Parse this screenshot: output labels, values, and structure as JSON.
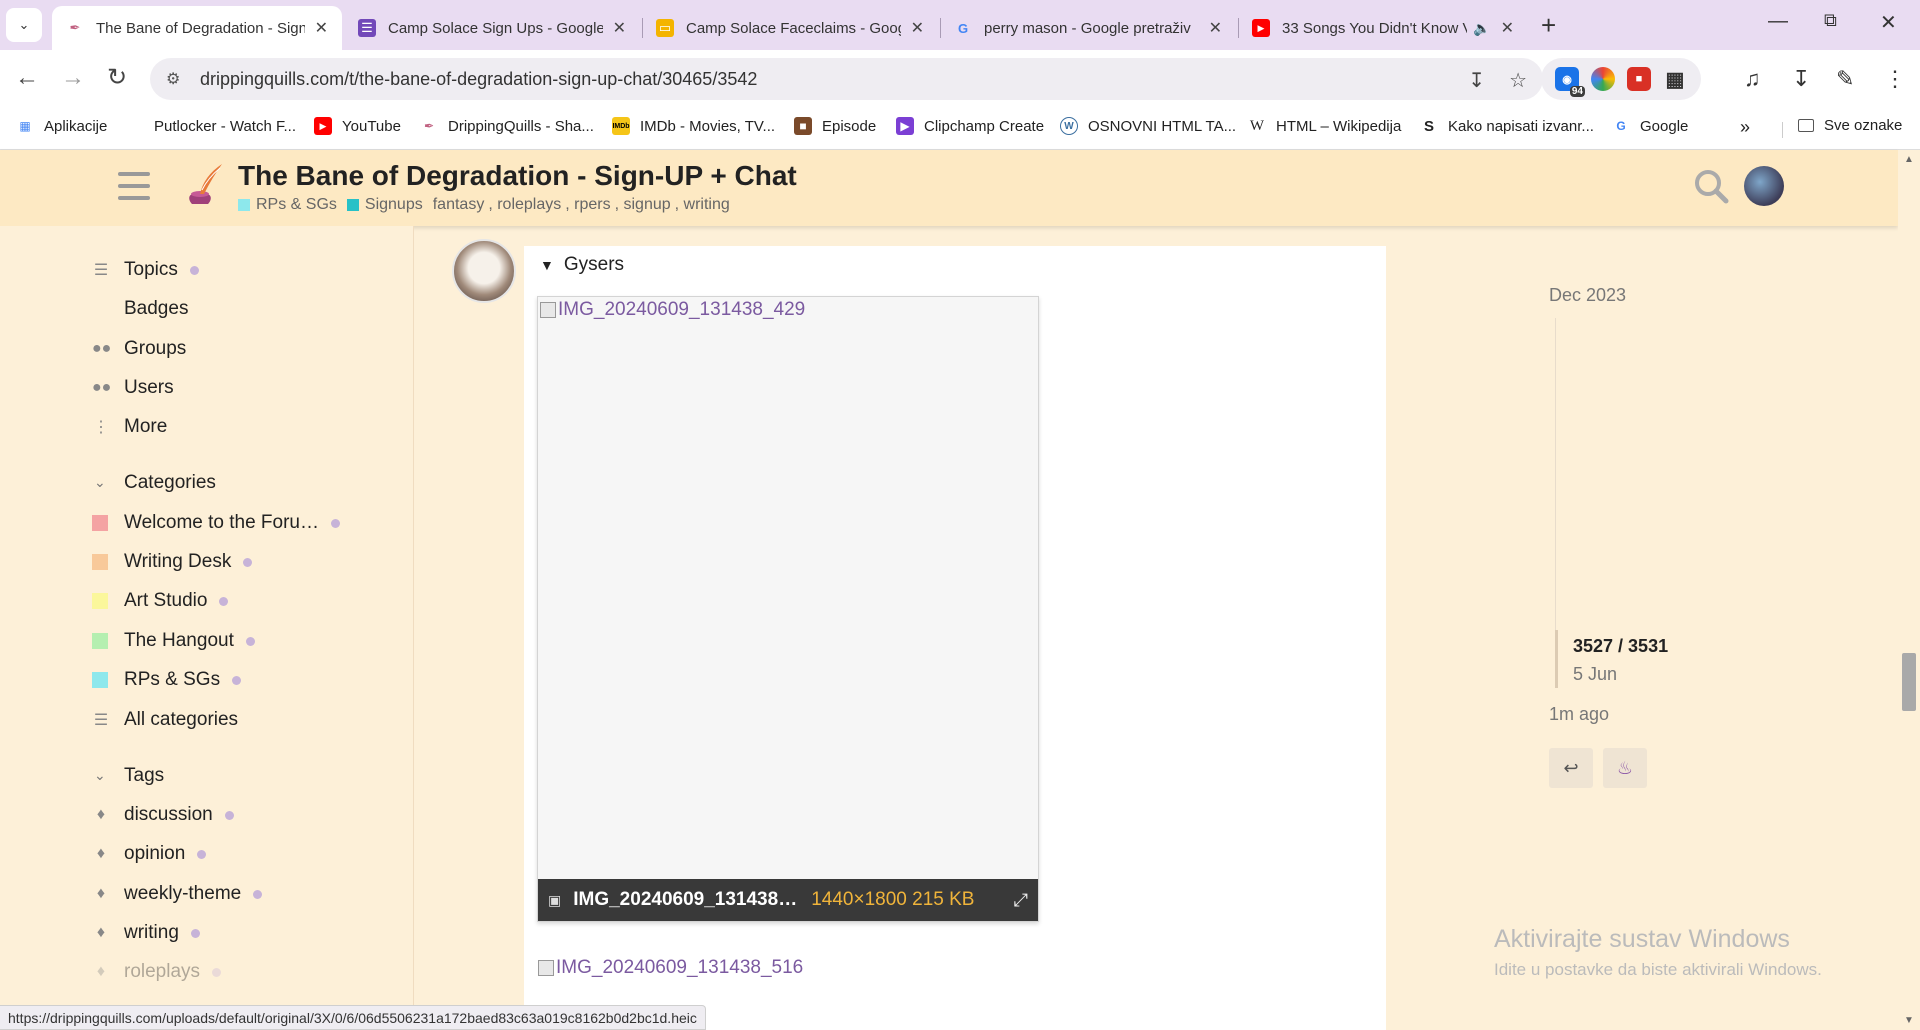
{
  "browser": {
    "tabs": [
      {
        "title": "The Bane of Degradation - Sign",
        "active": true,
        "favicon": "quill-icon"
      },
      {
        "title": "Camp Solace Sign Ups - Google",
        "active": false,
        "favicon": "google-forms-icon"
      },
      {
        "title": "Camp Solace Faceclaims - Goog",
        "active": false,
        "favicon": "google-slides-icon"
      },
      {
        "title": "perry mason - Google pretraživ",
        "active": false,
        "favicon": "google-icon"
      },
      {
        "title": "33 Songs You Didn't Know V",
        "active": false,
        "favicon": "youtube-icon"
      }
    ],
    "url": "drippingquills.com/t/the-bane-of-degradation-sign-up-chat/30465/3542",
    "extension_badge": "94",
    "bookmarks": [
      {
        "label": "Aplikacije",
        "icon": "apps-grid-icon"
      },
      {
        "label": "Putlocker - Watch F...",
        "icon": "blank-icon"
      },
      {
        "label": "YouTube",
        "icon": "youtube-icon"
      },
      {
        "label": "DrippingQuills - Sha...",
        "icon": "quill-icon"
      },
      {
        "label": "IMDb - Movies, TV...",
        "icon": "imdb-icon"
      },
      {
        "label": "Episode",
        "icon": "episode-icon"
      },
      {
        "label": "Clipchamp Create",
        "icon": "clipchamp-icon"
      },
      {
        "label": "OSNOVNI HTML TA...",
        "icon": "wordpress-icon"
      },
      {
        "label": "HTML – Wikipedija",
        "icon": "wikipedia-icon"
      },
      {
        "label": "Kako napisati izvanr...",
        "icon": "scribd-icon"
      },
      {
        "label": "Google",
        "icon": "google-icon"
      }
    ],
    "all_bookmarks": "Sve oznake",
    "status_url": "https://drippingquills.com/uploads/default/original/3X/0/6/06d5506231a172baed83c63a019c8162b0d2bc1d.heic"
  },
  "header": {
    "title": "The Bane of Degradation - Sign-UP + Chat",
    "categories": [
      {
        "label": "RPs & SGs",
        "color": "#8de8ec"
      },
      {
        "label": "Signups",
        "color": "#27c1c7"
      }
    ],
    "tags": [
      "fantasy",
      "roleplays",
      "rpers",
      "signup",
      "writing"
    ]
  },
  "sidebar": {
    "top_items": [
      {
        "label": "Topics",
        "icon": "layers-icon",
        "dot": true
      },
      {
        "label": "Badges",
        "icon": "",
        "dot": false
      },
      {
        "label": "Groups",
        "icon": "groups-icon",
        "dot": false
      },
      {
        "label": "Users",
        "icon": "users-icon",
        "dot": false
      },
      {
        "label": "More",
        "icon": "more-vertical-icon",
        "dot": false
      }
    ],
    "categories_heading": "Categories",
    "categories": [
      {
        "label": "Welcome to the Foru…",
        "color": "#f4a3a3"
      },
      {
        "label": "Writing Desk",
        "color": "#f8c99a"
      },
      {
        "label": "Art Studio",
        "color": "#fbf79b"
      },
      {
        "label": "The Hangout",
        "color": "#b5efb0"
      },
      {
        "label": "RPs & SGs",
        "color": "#8de8ec"
      }
    ],
    "all_categories": "All categories",
    "tags_heading": "Tags",
    "tags": [
      "discussion",
      "opinion",
      "weekly-theme",
      "writing",
      "roleplays"
    ]
  },
  "post": {
    "details_summary": "Gysers",
    "image1_alt": "IMG_20240609_131438_429",
    "image1_filename": "IMG_20240609_131438…",
    "image1_info": "1440×1800 215 KB",
    "image2_alt": "IMG_20240609_131438_516"
  },
  "timeline": {
    "start_date": "Dec 2023",
    "position": "3527 / 3531",
    "position_date": "5 Jun",
    "end_label": "1m ago"
  },
  "watermark": {
    "title": "Aktivirajte sustav Windows",
    "subtitle": "Idite u postavke da biste aktivirali Windows."
  }
}
